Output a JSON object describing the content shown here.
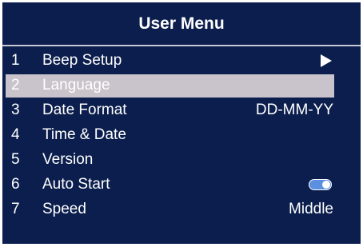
{
  "header": {
    "title": "User Menu"
  },
  "menu": {
    "items": [
      {
        "num": "1",
        "label": "Beep Setup",
        "value": ""
      },
      {
        "num": "2",
        "label": "Language",
        "value": ""
      },
      {
        "num": "3",
        "label": "Date Format",
        "value": "DD-MM-YY"
      },
      {
        "num": "4",
        "label": "Time & Date",
        "value": ""
      },
      {
        "num": "5",
        "label": "Version",
        "value": ""
      },
      {
        "num": "6",
        "label": "Auto Start",
        "value": ""
      },
      {
        "num": "7",
        "label": "Speed",
        "value": "Middle"
      }
    ],
    "selected_index": 1,
    "auto_start_enabled": true
  },
  "colors": {
    "background": "#0b1e4d",
    "selection": "#c9c3cb",
    "toggle_on": "#5b8fe0",
    "text": "#ffffff"
  },
  "icons": {
    "beep_setup": "play-arrow-icon",
    "auto_start": "toggle-switch-icon"
  }
}
